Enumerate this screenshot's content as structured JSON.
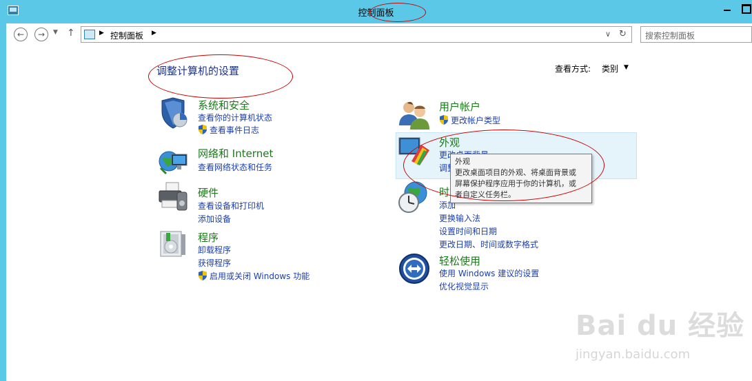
{
  "window": {
    "title": "控制面板"
  },
  "address": {
    "crumb": "控制面板",
    "search_placeholder": "搜索控制面板"
  },
  "header": {
    "title": "调整计算机的设置",
    "view_label": "查看方式:",
    "view_value": "类别"
  },
  "categories_left": [
    {
      "title": "系统和安全",
      "links": [
        "查看你的计算机状态",
        "查看事件日志"
      ]
    },
    {
      "title": "网络和 Internet",
      "links": [
        "查看网络状态和任务"
      ]
    },
    {
      "title": "硬件",
      "links": [
        "查看设备和打印机",
        "添加设备"
      ]
    },
    {
      "title": "程序",
      "links": [
        "卸载程序",
        "获得程序",
        "启用或关闭 Windows 功能"
      ]
    }
  ],
  "categories_right": [
    {
      "title": "用户帐户",
      "links": [
        "更改帐户类型"
      ]
    },
    {
      "title": "外观",
      "links": [
        "更改桌面背景",
        "调整"
      ]
    },
    {
      "title": "时",
      "links": [
        "添加",
        "更换输入法",
        "设置时间和日期",
        "更改日期、时间或数字格式"
      ]
    },
    {
      "title": "轻松使用",
      "links": [
        "使用 Windows 建议的设置",
        "优化视觉显示"
      ]
    }
  ],
  "tooltip": {
    "title": "外观",
    "line1": "更改桌面项目的外观、将桌面背景或",
    "line2": "屏幕保护程序应用于你的计算机，或",
    "line3": "者自定义任务栏。"
  },
  "watermark": {
    "logo": "Bai du 经验",
    "url": "jingyan.baidu.com"
  },
  "colors": {
    "title_bar": "#5bc8e8",
    "link": "#1c3fb0",
    "category": "#1a7a1a",
    "annotation": "#cc0000"
  }
}
